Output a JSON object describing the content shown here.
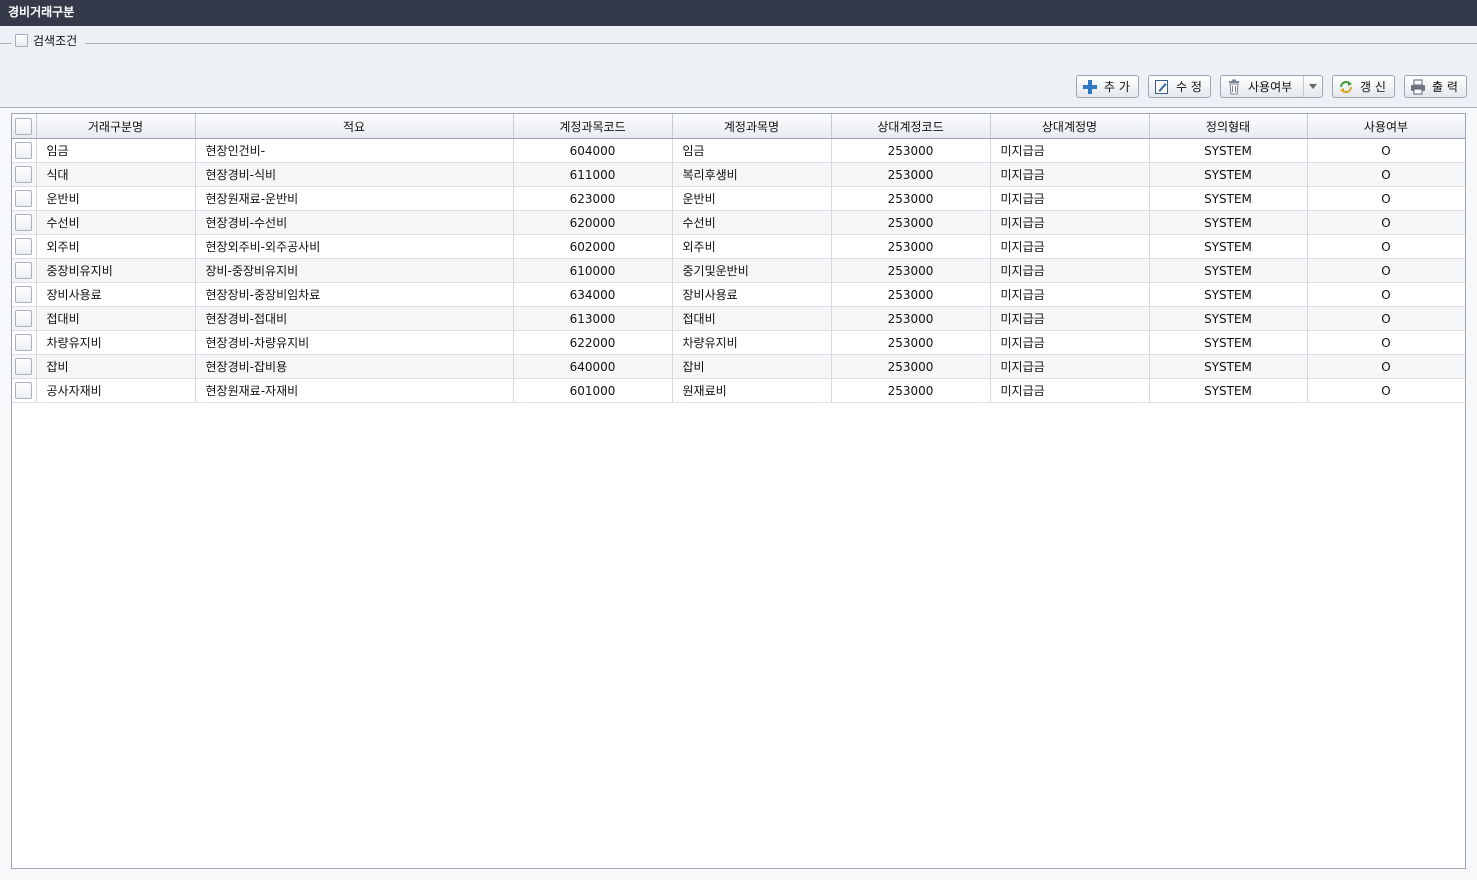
{
  "window": {
    "title": "경비거래구분"
  },
  "search": {
    "label": "검색조건"
  },
  "toolbar": {
    "add_label": "추 가",
    "edit_label": "수 정",
    "use_label": "사용여부",
    "refresh_label": "갱 신",
    "print_label": "출 력"
  },
  "grid": {
    "columns": [
      "거래구분명",
      "적요",
      "계정과목코드",
      "계정과목명",
      "상대계정코드",
      "상대계정명",
      "정의형태",
      "사용여부"
    ],
    "rows": [
      [
        "임금",
        "현장인건비-",
        "604000",
        "임금",
        "253000",
        "미지급금",
        "SYSTEM",
        "O"
      ],
      [
        "식대",
        "현장경비-식비",
        "611000",
        "복리후생비",
        "253000",
        "미지급금",
        "SYSTEM",
        "O"
      ],
      [
        "운반비",
        "현장원재료-운반비",
        "623000",
        "운반비",
        "253000",
        "미지급금",
        "SYSTEM",
        "O"
      ],
      [
        "수선비",
        "현장경비-수선비",
        "620000",
        "수선비",
        "253000",
        "미지급금",
        "SYSTEM",
        "O"
      ],
      [
        "외주비",
        "현장외주비-외주공사비",
        "602000",
        "외주비",
        "253000",
        "미지급금",
        "SYSTEM",
        "O"
      ],
      [
        "중장비유지비",
        "장비-중장비유지비",
        "610000",
        "중기및운반비",
        "253000",
        "미지급금",
        "SYSTEM",
        "O"
      ],
      [
        "장비사용료",
        "현장장비-중장비임차료",
        "634000",
        "장비사용료",
        "253000",
        "미지급금",
        "SYSTEM",
        "O"
      ],
      [
        "접대비",
        "현장경비-접대비",
        "613000",
        "접대비",
        "253000",
        "미지급금",
        "SYSTEM",
        "O"
      ],
      [
        "차량유지비",
        "현장경비-차량유지비",
        "622000",
        "차량유지비",
        "253000",
        "미지급금",
        "SYSTEM",
        "O"
      ],
      [
        "잡비",
        "현장경비-잡비용",
        "640000",
        "잡비",
        "253000",
        "미지급금",
        "SYSTEM",
        "O"
      ],
      [
        "공사자재비",
        "현장원재료-자재비",
        "601000",
        "원재료비",
        "253000",
        "미지급금",
        "SYSTEM",
        "O"
      ]
    ]
  }
}
